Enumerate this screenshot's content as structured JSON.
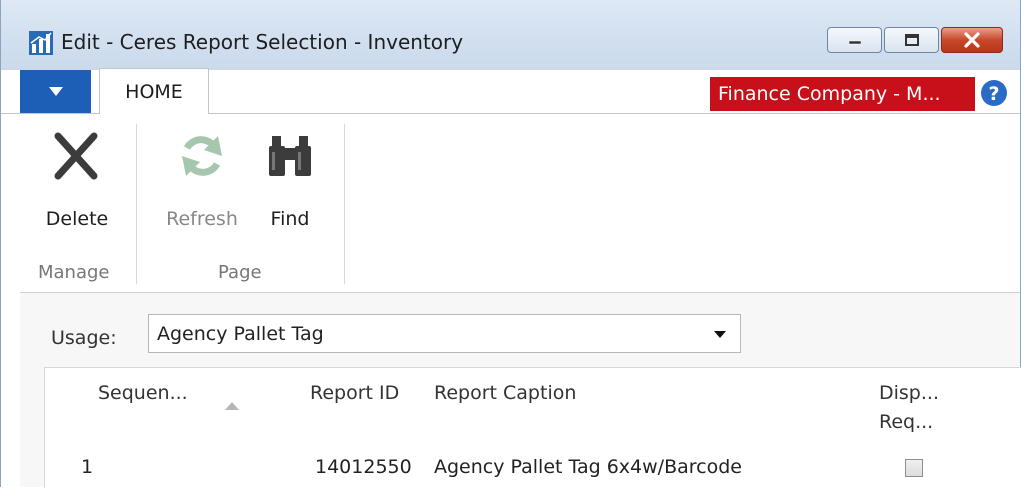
{
  "window": {
    "title": "Edit - Ceres Report Selection - Inventory",
    "controls": [
      "minimize",
      "maximize",
      "close"
    ]
  },
  "tabs": {
    "app_menu_icon": "dropdown-arrow-icon",
    "home": "HOME",
    "company": "Finance Company - M...",
    "help_icon": "help-icon"
  },
  "ribbon": {
    "groups": [
      {
        "label": "Manage",
        "buttons": [
          {
            "label": "Delete",
            "icon": "delete-x-icon",
            "enabled": true
          }
        ]
      },
      {
        "label": "Page",
        "buttons": [
          {
            "label": "Refresh",
            "icon": "refresh-icon",
            "enabled": false
          },
          {
            "label": "Find",
            "icon": "binoculars-icon",
            "enabled": true
          }
        ]
      }
    ]
  },
  "usage": {
    "label": "Usage:",
    "value": "Agency Pallet Tag"
  },
  "table": {
    "columns": [
      "Sequen...",
      "Report ID",
      "Report Caption",
      "Disp...",
      "Req..."
    ],
    "sort_column": "Sequen...",
    "rows": [
      {
        "sequence": "1",
        "report_id": "14012550",
        "caption": "Agency Pallet Tag 6x4w/Barcode",
        "checked": false
      }
    ]
  },
  "colors": {
    "app_menu": "#1d5fb6",
    "company_badge": "#c8101b",
    "titlebar": "#d2e0f0"
  }
}
